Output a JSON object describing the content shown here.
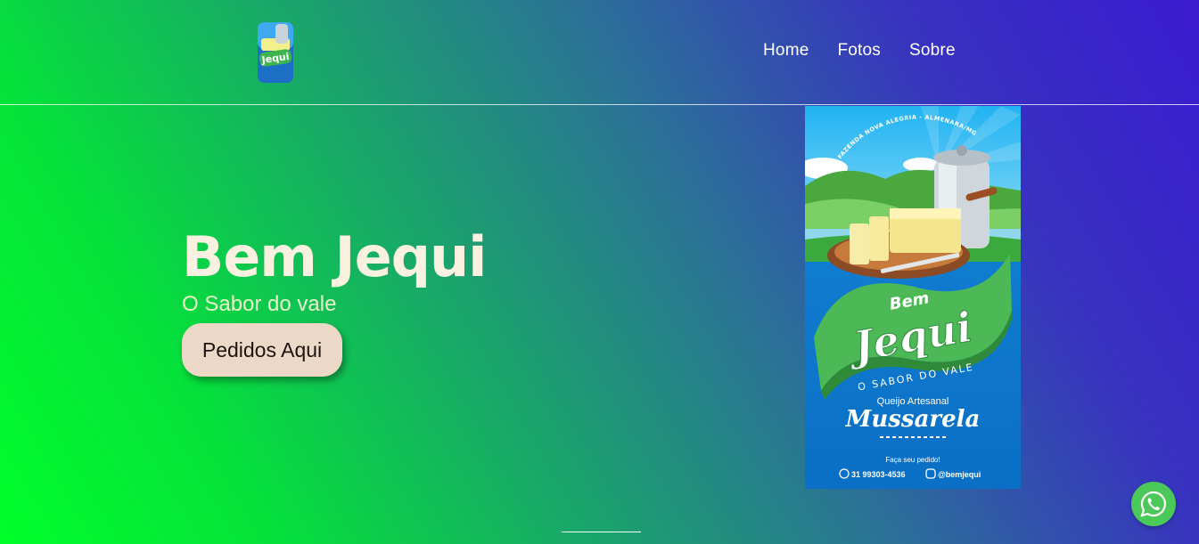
{
  "header": {
    "logo_alt": "Bem Jequi",
    "nav": [
      {
        "label": "Home"
      },
      {
        "label": "Fotos"
      },
      {
        "label": "Sobre"
      }
    ]
  },
  "hero": {
    "title": "Bem Jequi",
    "subtitle": "O Sabor do vale",
    "cta_label": "Pedidos Aqui"
  },
  "poster": {
    "arc_text": "FAZENDA NOVA ALEGRIA - ALMENARA/MG",
    "brand_small": "Bem",
    "brand_big": "Jequi",
    "tagline": "O SABOR DO VALE",
    "product_kind": "Queijo Artesanal",
    "product_name": "Mussarela",
    "cta": "Faça seu pedido!",
    "phone": "31 99303-4536",
    "instagram": "@bemjequi"
  },
  "icons": {
    "whatsapp": "whatsapp-icon",
    "logo": "bem-jequi-logo"
  },
  "colors": {
    "whatsapp_green": "#4ac959",
    "cta_bg": "#ecd8c6",
    "title_color": "#fbf1e0",
    "poster_blue": "#0a78d1"
  }
}
